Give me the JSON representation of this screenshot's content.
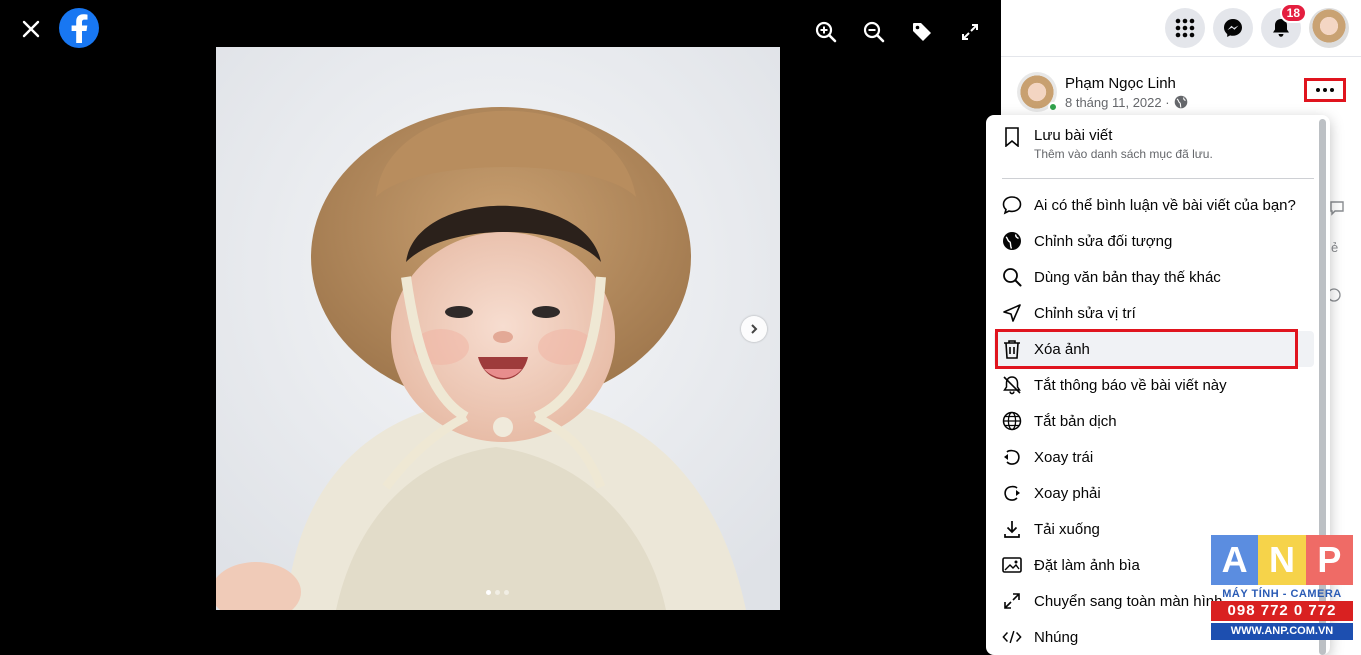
{
  "viewer": {
    "close_icon": "close-icon",
    "logo": "facebook-logo",
    "tools": [
      "zoom-in-icon",
      "zoom-out-icon",
      "tag-icon",
      "fullscreen-icon"
    ],
    "photo_dots": {
      "count": 3,
      "active": 0
    }
  },
  "topbar": {
    "notification_count": "18"
  },
  "post": {
    "author": "Phạm Ngọc Linh",
    "date": "8 tháng 11, 2022 ·"
  },
  "menu": {
    "items": [
      {
        "label": "Lưu bài viết",
        "sub": "Thêm vào danh sách mục đã lưu.",
        "icon": "bookmark-icon"
      },
      {
        "label": "Ai có thể bình luận về bài viết của bạn?",
        "icon": "comment-icon"
      },
      {
        "label": "Chỉnh sửa đối tượng",
        "icon": "globe-filled-icon"
      },
      {
        "label": "Dùng văn bản thay thế khác",
        "icon": "search-icon"
      },
      {
        "label": "Chỉnh sửa vị trí",
        "icon": "location-arrow-icon"
      },
      {
        "label": "Xóa ảnh",
        "icon": "trash-icon"
      },
      {
        "label": "Tắt thông báo về bài viết này",
        "icon": "bell-off-icon"
      },
      {
        "label": "Tắt bản dịch",
        "icon": "globe-icon"
      },
      {
        "label": "Xoay trái",
        "icon": "rotate-left-icon"
      },
      {
        "label": "Xoay phải",
        "icon": "rotate-right-icon"
      },
      {
        "label": "Tải xuống",
        "icon": "download-icon"
      },
      {
        "label": "Đặt làm ảnh bìa",
        "icon": "image-icon"
      },
      {
        "label": "Chuyển sang toàn màn hình",
        "icon": "expand-icon"
      },
      {
        "label": "Nhúng",
        "icon": "code-icon"
      }
    ]
  },
  "watermark": {
    "letters": [
      "A",
      "N",
      "P"
    ],
    "tagline": "MÁY TÍNH - CAMERA",
    "phone": "098 772 0 772",
    "url": "WWW.ANP.COM.VN"
  },
  "colors": {
    "facebook_blue": "#1877f2",
    "highlight_red": "#e0141e",
    "badge_red": "#e41e3f"
  }
}
